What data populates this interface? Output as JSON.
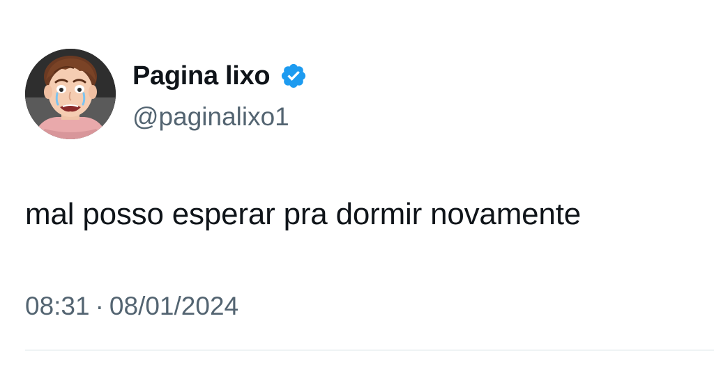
{
  "author": {
    "display_name": "Pagina lixo",
    "handle": "@paginalixo1",
    "verified": true,
    "avatar_icon": "crying-cartoon-face-avatar"
  },
  "tweet": {
    "text": "mal posso esperar pra dormir novamente",
    "time": "08:31",
    "separator": "·",
    "date": "08/01/2024"
  },
  "colors": {
    "text_primary": "#0f1419",
    "text_secondary": "#536471",
    "verified_badge": "#1d9bf0",
    "divider": "#eff3f4"
  }
}
